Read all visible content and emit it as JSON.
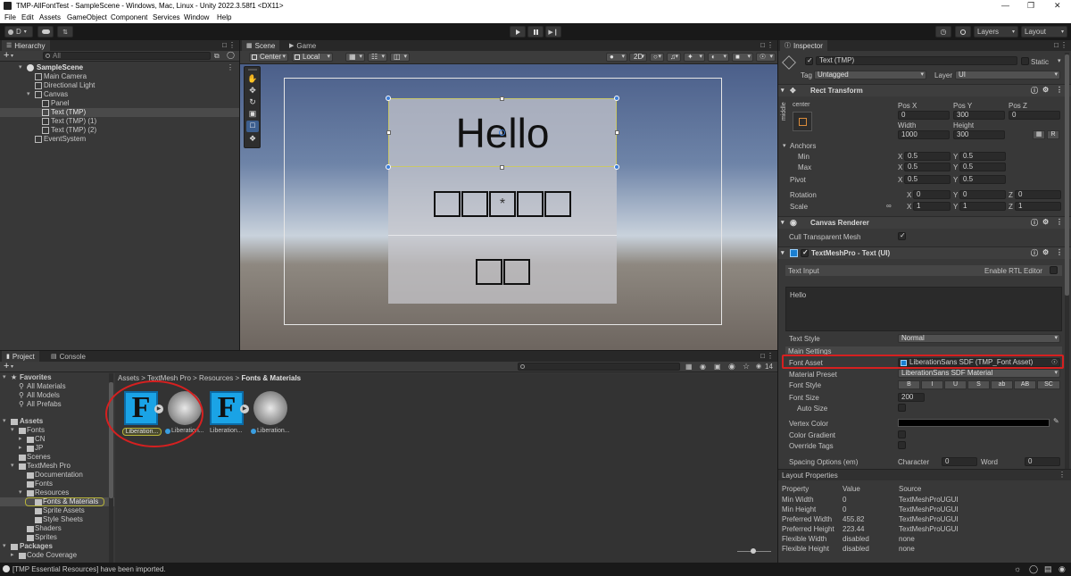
{
  "window": {
    "title": "TMP-AllFontTest - SampleScene - Windows, Mac, Linux - Unity 2022.3.58f1 <DX11>",
    "controls": [
      "—",
      "❐",
      "✕"
    ]
  },
  "menu": [
    "File",
    "Edit",
    "Assets",
    "GameObject",
    "Component",
    "Services",
    "Window",
    "Help"
  ],
  "toolbar": {
    "account": "D",
    "layers": "Layers",
    "layout": "Layout"
  },
  "hierarchy": {
    "tab": "Hierarchy",
    "search_placeholder": "All",
    "items": [
      {
        "label": "SampleScene"
      },
      {
        "label": "Main Camera"
      },
      {
        "label": "Directional Light"
      },
      {
        "label": "Canvas"
      },
      {
        "label": "Panel"
      },
      {
        "label": "Text (TMP)"
      },
      {
        "label": "Text (TMP) (1)"
      },
      {
        "label": "Text (TMP) (2)"
      },
      {
        "label": "EventSystem"
      }
    ]
  },
  "scene": {
    "tabs": [
      "Scene",
      "Game"
    ],
    "pivot": "Center",
    "space": "Local",
    "mode_2d": "2D",
    "hello_text": "Hello",
    "missing_glyph": "*"
  },
  "inspector": {
    "tab": "Inspector",
    "object_name": "Text (TMP)",
    "static_label": "Static",
    "tag_label": "Tag",
    "tag_value": "Untagged",
    "layer_label": "Layer",
    "layer_value": "UI",
    "rect_transform": {
      "header": "Rect Transform",
      "anchor_label": "center",
      "anchor_side": "middle",
      "pos_x_label": "Pos X",
      "pos_x": "0",
      "pos_y_label": "Pos Y",
      "pos_y": "300",
      "pos_z_label": "Pos Z",
      "pos_z": "0",
      "width_label": "Width",
      "width": "1000",
      "height_label": "Height",
      "height": "300",
      "r_button": "R",
      "anchors_label": "Anchors",
      "min_label": "Min",
      "min_x": "0.5",
      "min_y": "0.5",
      "max_label": "Max",
      "max_x": "0.5",
      "max_y": "0.5",
      "pivot_label": "Pivot",
      "pivot_x": "0.5",
      "pivot_y": "0.5",
      "rotation_label": "Rotation",
      "rot_x": "0",
      "rot_y": "0",
      "rot_z": "0",
      "scale_label": "Scale",
      "scale_x": "1",
      "scale_y": "1",
      "scale_z": "1",
      "axis_x": "X",
      "axis_y": "Y",
      "axis_z": "Z"
    },
    "canvas_renderer": {
      "header": "Canvas Renderer",
      "cull_label": "Cull Transparent Mesh"
    },
    "tmp": {
      "header": "TextMeshPro - Text (UI)",
      "text_input_label": "Text Input",
      "rtl_label": "Enable RTL Editor",
      "text_value": "Hello",
      "text_style_label": "Text Style",
      "text_style_value": "Normal",
      "main_settings": "Main Settings",
      "font_asset_label": "Font Asset",
      "font_asset_value": "LiberationSans SDF (TMP_Font Asset)",
      "material_preset_label": "Material Preset",
      "material_preset_value": "LiberationSans SDF Material",
      "font_style_label": "Font Style",
      "font_styles": [
        "B",
        "I",
        "U",
        "S",
        "ab",
        "AB",
        "SC"
      ],
      "font_size_label": "Font Size",
      "font_size_value": "200",
      "auto_size_label": "Auto Size",
      "vertex_color_label": "Vertex Color",
      "color_gradient_label": "Color Gradient",
      "override_tags_label": "Override Tags",
      "spacing_label": "Spacing Options (em)",
      "character_label": "Character",
      "character_value": "0",
      "word_label": "Word",
      "word_value": "0"
    },
    "layout_properties": {
      "header": "Layout Properties",
      "col_property": "Property",
      "col_value": "Value",
      "col_source": "Source",
      "rows": [
        {
          "property": "Min Width",
          "value": "0",
          "source": "TextMeshProUGUI"
        },
        {
          "property": "Min Height",
          "value": "0",
          "source": "TextMeshProUGUI"
        },
        {
          "property": "Preferred Width",
          "value": "455.82",
          "source": "TextMeshProUGUI"
        },
        {
          "property": "Preferred Height",
          "value": "223.44",
          "source": "TextMeshProUGUI"
        },
        {
          "property": "Flexible Width",
          "value": "disabled",
          "source": "none"
        },
        {
          "property": "Flexible Height",
          "value": "disabled",
          "source": "none"
        }
      ]
    }
  },
  "project": {
    "tabs": [
      "Project",
      "Console"
    ],
    "count": "14",
    "breadcrumb": [
      "Assets",
      "TextMesh Pro",
      "Resources",
      "Fonts & Materials"
    ],
    "tree": [
      {
        "label": "Favorites"
      },
      {
        "label": "All Materials"
      },
      {
        "label": "All Models"
      },
      {
        "label": "All Prefabs"
      },
      {
        "label": "Assets"
      },
      {
        "label": "Fonts"
      },
      {
        "label": "CN"
      },
      {
        "label": "JP"
      },
      {
        "label": "Scenes"
      },
      {
        "label": "TextMesh Pro"
      },
      {
        "label": "Documentation"
      },
      {
        "label": "Fonts"
      },
      {
        "label": "Resources"
      },
      {
        "label": "Fonts & Materials"
      },
      {
        "label": "Sprite Assets"
      },
      {
        "label": "Style Sheets"
      },
      {
        "label": "Shaders"
      },
      {
        "label": "Sprites"
      },
      {
        "label": "Packages"
      },
      {
        "label": "Code Coverage"
      }
    ],
    "assets": [
      {
        "label": "Liberation...",
        "glyph": "F"
      },
      {
        "label": "Liberation...",
        "glyph": ""
      },
      {
        "label": "Liberation...",
        "glyph": "F"
      },
      {
        "label": "Liberation...",
        "glyph": ""
      }
    ]
  },
  "status": {
    "message": "[TMP Essential Resources] have been imported."
  },
  "colors": {
    "highlight": "#d62020",
    "selection_ring": "#b8b43a",
    "font_icon": "#1aa3e6"
  }
}
